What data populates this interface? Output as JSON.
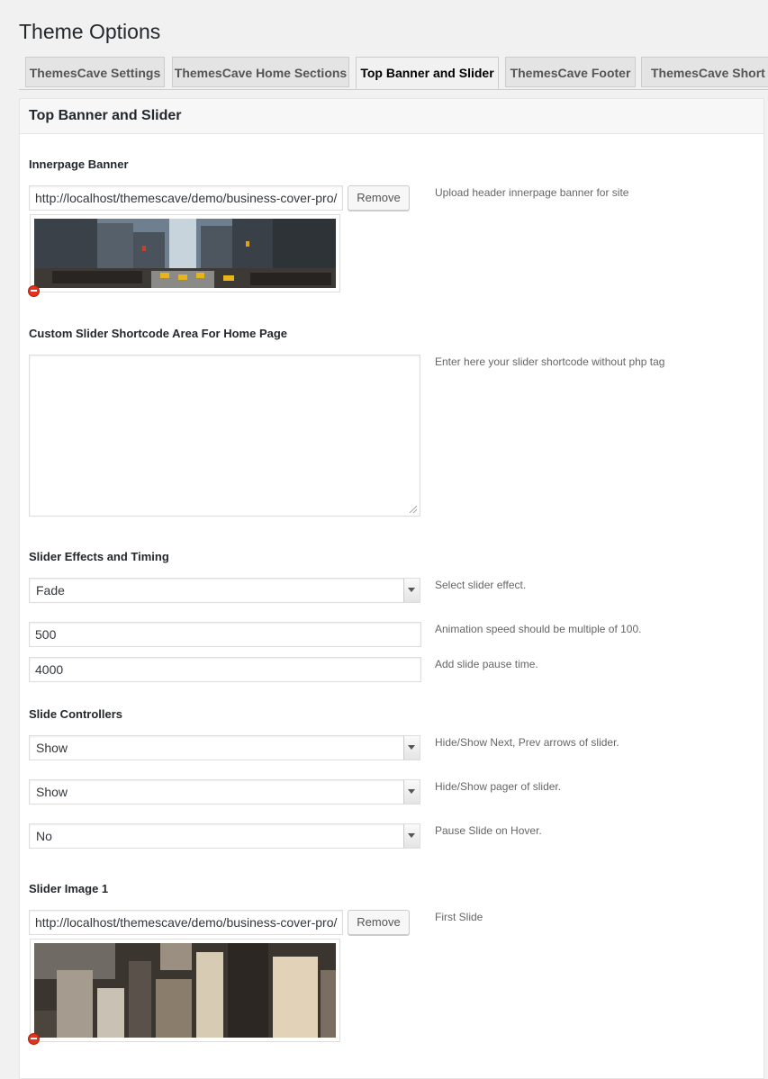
{
  "page": {
    "title": "Theme Options"
  },
  "tabs": [
    {
      "label": "ThemesCave Settings"
    },
    {
      "label": "ThemesCave Home Sections"
    },
    {
      "label": "Top Banner and Slider"
    },
    {
      "label": "ThemesCave Footer"
    },
    {
      "label": "ThemesCave Short Codes"
    }
  ],
  "panel": {
    "title": "Top Banner and Slider",
    "innerpage_banner": {
      "label": "Innerpage Banner",
      "url": "http://localhost/themescave/demo/business-cover-pro/",
      "remove_label": "Remove",
      "desc": "Upload header innerpage banner for site"
    },
    "shortcode": {
      "label": "Custom Slider Shortcode Area For Home Page",
      "value": "",
      "desc": "Enter here your slider shortcode without php tag"
    },
    "effects": {
      "label": "Slider Effects and Timing",
      "effect_value": "Fade",
      "effect_desc": "Select slider effect.",
      "speed_value": "500",
      "speed_desc": "Animation speed should be multiple of 100.",
      "pause_value": "4000",
      "pause_desc": "Add slide pause time."
    },
    "controllers": {
      "label": "Slide Controllers",
      "arrows_value": "Show",
      "arrows_desc": "Hide/Show Next, Prev arrows of slider.",
      "pager_value": "Show",
      "pager_desc": "Hide/Show pager of slider.",
      "hover_value": "No",
      "hover_desc": "Pause Slide on Hover."
    },
    "slider_image_1": {
      "label": "Slider Image 1",
      "url": "http://localhost/themescave/demo/business-cover-pro/",
      "remove_label": "Remove",
      "desc": "First Slide"
    }
  }
}
